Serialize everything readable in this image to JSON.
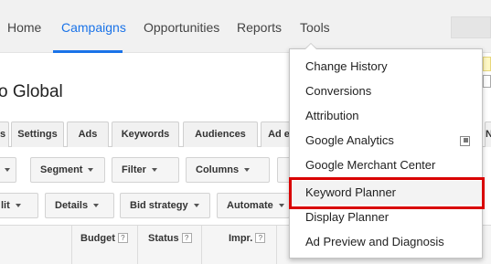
{
  "nav": {
    "items": [
      {
        "label": "Home"
      },
      {
        "label": "Campaigns",
        "active": true
      },
      {
        "label": "Opportunities"
      },
      {
        "label": "Reports"
      },
      {
        "label": "Tools"
      }
    ]
  },
  "account": {
    "title": "o Global"
  },
  "tabs": [
    {
      "label": "s"
    },
    {
      "label": "Settings"
    },
    {
      "label": "Ads"
    },
    {
      "label": "Keywords"
    },
    {
      "label": "Audiences"
    },
    {
      "label": "Ad e"
    }
  ],
  "right_edge": {
    "label": "N"
  },
  "toolbar_row1": [
    {
      "label": "Segment"
    },
    {
      "label": "Filter"
    },
    {
      "label": "Columns"
    }
  ],
  "toolbar_row2": [
    {
      "label": "lit"
    },
    {
      "label": "Details"
    },
    {
      "label": "Bid strategy"
    },
    {
      "label": "Automate"
    }
  ],
  "table": {
    "headers": [
      {
        "label": "Budget",
        "help": "?"
      },
      {
        "label": "Status",
        "help": "?"
      },
      {
        "label": "Impr.",
        "help": "?"
      }
    ]
  },
  "tools_menu": {
    "items": [
      {
        "label": "Change History"
      },
      {
        "label": "Conversions"
      },
      {
        "label": "Attribution"
      },
      {
        "label": "Google Analytics",
        "external": true
      },
      {
        "label": "Google Merchant Center"
      },
      {
        "label": "Keyword Planner",
        "highlighted": true
      },
      {
        "label": "Display Planner"
      },
      {
        "label": "Ad Preview and Diagnosis"
      }
    ]
  },
  "colors": {
    "accent": "#1a73e8",
    "highlight_outline": "#d90000"
  }
}
